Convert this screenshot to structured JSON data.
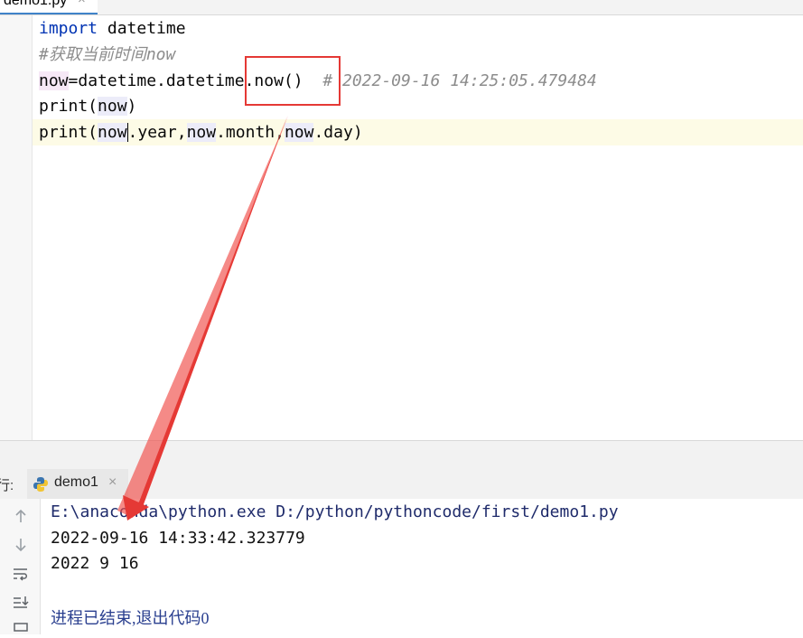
{
  "editor": {
    "tab": {
      "filename": "demo1.py",
      "close": "×"
    },
    "lines": {
      "l1_kw": "import",
      "l1_rest": " datetime",
      "l2": "#获取当前时间now",
      "l3_var": "now",
      "l3_mid": "=datetime.datetime",
      "l3_call": ".now()",
      "l3_comment": "# 2022-09-16 14:25:05.479484",
      "l4_a": "print(",
      "l4_b": "now",
      "l4_c": ")",
      "l5_a": "print(",
      "l5_b": "now",
      "l5_c": ".year,",
      "l5_d": "now",
      "l5_e": ".month,",
      "l5_f": "now",
      "l5_g": ".day)"
    }
  },
  "run_window": {
    "label": "行:",
    "tab_name": "demo1",
    "tab_close": "×",
    "toolbar": [
      "arrow-up-icon",
      "arrow-down-icon",
      "soft-wrap-icon",
      "scroll-to-end-icon",
      "print-icon"
    ],
    "console": {
      "command": "E:\\anaconda\\python.exe D:/python/pythoncode/first/demo1.py",
      "output1": "2022-09-16 14:33:42.323779",
      "output2": "2022 9 16",
      "exit": "进程已结束,退出代码0"
    }
  },
  "annotation": {
    "color": "#e53935"
  }
}
